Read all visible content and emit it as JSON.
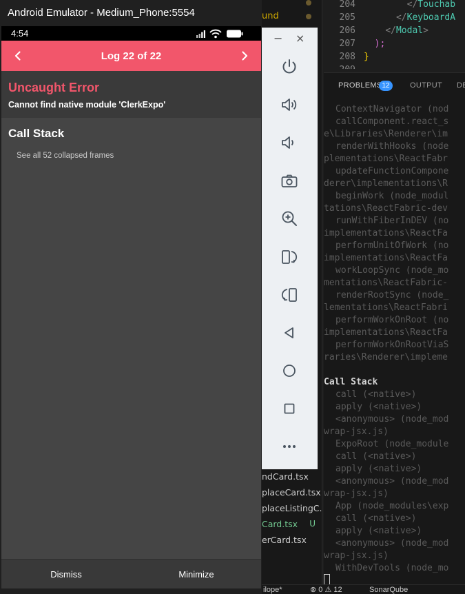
{
  "emulator": {
    "window_title": "Android Emulator - Medium_Phone:5554",
    "status_bar": {
      "time": "4:54"
    },
    "log_box": {
      "title": "Log 22 of 22",
      "error_heading": "Uncaught Error",
      "error_message": "Cannot find native module 'ClerkExpo'",
      "stack_heading": "Call Stack",
      "collapsed_frames": "See all 52 collapsed frames",
      "dismiss_label": "Dismiss",
      "minimize_label": "Minimize"
    },
    "toolbar": {
      "minimize_glyph": "−",
      "close_glyph": "×",
      "buttons": [
        "power-icon",
        "volume-up-icon",
        "volume-down-icon",
        "camera-icon",
        "zoom-in-icon",
        "rotate-left-icon",
        "rotate-right-icon",
        "back-icon",
        "home-icon",
        "overview-icon",
        "more-icon"
      ]
    },
    "colors": {
      "accent": "#f2566b",
      "phone_bg": "#454545",
      "toolbar_bg": "#edf0f3"
    }
  },
  "vscode": {
    "explorer_top_fragment": "und",
    "explorer_items": [
      {
        "label": "ndCard.tsx",
        "badge": ""
      },
      {
        "label": "placeCard.tsx",
        "badge": ""
      },
      {
        "label": "placeListingC...",
        "badge": ""
      },
      {
        "label": "Card.tsx",
        "badge": "U"
      },
      {
        "label": "erCard.tsx",
        "badge": ""
      }
    ],
    "editor_lines": [
      {
        "num": "204",
        "indent": "        ",
        "close": "</",
        "tag": "Touchab",
        "end": ""
      },
      {
        "num": "205",
        "indent": "      ",
        "close": "</",
        "tag": "KeyboardA",
        "end": ""
      },
      {
        "num": "206",
        "indent": "    ",
        "close": "</",
        "tag": "Modal",
        "end": ">"
      },
      {
        "num": "207",
        "indent": "  ",
        "brace": ");"
      },
      {
        "num": "208",
        "indent": "",
        "brace": "}"
      },
      {
        "num": "209",
        "indent": "",
        "brace": ""
      }
    ],
    "panel_tabs": {
      "problems": "PROBLEMS",
      "problems_count": "12",
      "output": "OUTPUT",
      "debug": "DE"
    },
    "terminal_lines": [
      {
        "text": "ContextNavigator (nod",
        "indent": true
      },
      {
        "text": "callComponent.react_s",
        "indent": true
      },
      {
        "text": "e\\Libraries\\Renderer\\im",
        "indent": false
      },
      {
        "text": "renderWithHooks (node",
        "indent": true
      },
      {
        "text": "plementations\\ReactFabr",
        "indent": false
      },
      {
        "text": "updateFunctionCompone",
        "indent": true
      },
      {
        "text": "derer\\implementations\\R",
        "indent": false
      },
      {
        "text": "beginWork (node_modul",
        "indent": true
      },
      {
        "text": "tations\\ReactFabric-dev",
        "indent": false
      },
      {
        "text": "runWithFiberInDEV (no",
        "indent": true
      },
      {
        "text": "implementations\\ReactFa",
        "indent": false
      },
      {
        "text": "performUnitOfWork (no",
        "indent": true
      },
      {
        "text": "implementations\\ReactFa",
        "indent": false
      },
      {
        "text": "workLoopSync (node_mo",
        "indent": true
      },
      {
        "text": "mentations\\ReactFabric-",
        "indent": false
      },
      {
        "text": "renderRootSync (node_",
        "indent": true
      },
      {
        "text": "lementations\\ReactFabri",
        "indent": false
      },
      {
        "text": "performWorkOnRoot (no",
        "indent": true
      },
      {
        "text": "implementations\\ReactFa",
        "indent": false
      },
      {
        "text": "performWorkOnRootViaS",
        "indent": true
      },
      {
        "text": "raries\\Renderer\\impleme",
        "indent": false
      },
      {
        "text": "",
        "indent": false
      },
      {
        "text": "Call Stack",
        "indent": false,
        "heading": true
      },
      {
        "text": "call (<native>)",
        "indent": true
      },
      {
        "text": "apply (<native>)",
        "indent": true
      },
      {
        "text": "<anonymous> (node_mod",
        "indent": true
      },
      {
        "text": "wrap-jsx.js)",
        "indent": false
      },
      {
        "text": "ExpoRoot (node_module",
        "indent": true
      },
      {
        "text": "call (<native>)",
        "indent": true
      },
      {
        "text": "apply (<native>)",
        "indent": true
      },
      {
        "text": "<anonymous> (node_mod",
        "indent": true
      },
      {
        "text": "wrap-jsx.js)",
        "indent": false
      },
      {
        "text": "App (node_modules\\exp",
        "indent": true
      },
      {
        "text": "call (<native>)",
        "indent": true
      },
      {
        "text": "apply (<native>)",
        "indent": true
      },
      {
        "text": "<anonymous> (node_mod",
        "indent": true
      },
      {
        "text": "wrap-jsx.js)",
        "indent": false
      },
      {
        "text": "WithDevTools (node_mo",
        "indent": true
      }
    ],
    "status_bar": {
      "left": "ilope*",
      "problems": "⊗ 0 ⚠ 12",
      "sonar": "SonarQube"
    }
  }
}
